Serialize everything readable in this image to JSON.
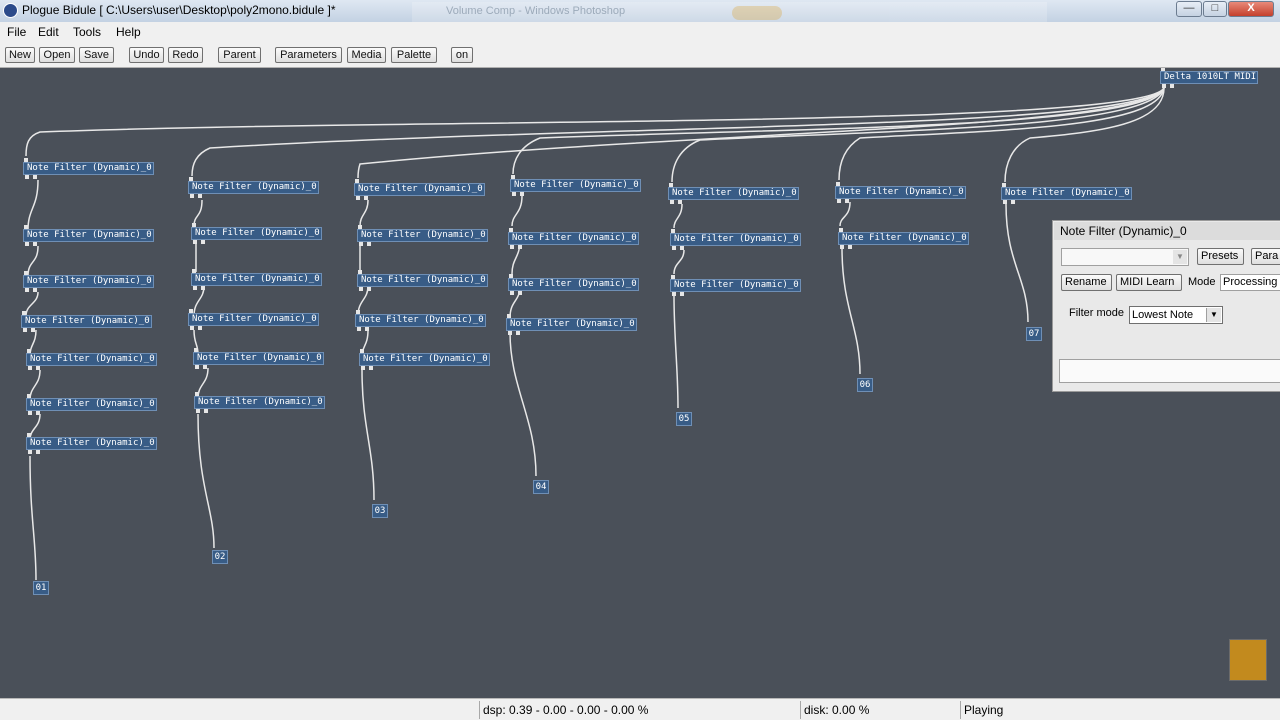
{
  "window": {
    "title": "Plogue Bidule [ C:\\Users\\user\\Desktop\\poly2mono.bidule ]*",
    "background_window_title": "Volume Comp - Windows Photoshop",
    "minimize": "—",
    "maximize": "□",
    "close": "X"
  },
  "menu": [
    "File",
    "Edit",
    "Tools",
    "Help"
  ],
  "toolbar": [
    "New",
    "Open",
    "Save",
    "Undo",
    "Redo",
    "Parent",
    "Parameters",
    "Media",
    "Palette",
    "on"
  ],
  "midi_device": "Delta 1010LT MIDI",
  "node_label": "Note Filter (Dynamic)_0",
  "outputs": [
    "01",
    "02",
    "03",
    "04",
    "05",
    "06",
    "07"
  ],
  "panel": {
    "title": "Note Filter (Dynamic)_0",
    "presets": "Presets",
    "parameters": "Para",
    "rename": "Rename",
    "midi_learn": "MIDI Learn",
    "mode_label": "Mode",
    "mode_value": "Processing",
    "filter_mode_label": "Filter mode",
    "filter_mode_value": "Lowest Note"
  },
  "status": {
    "dsp": "dsp:  0.39 -  0.00 -  0.00 -  0.00 %",
    "disk": "disk:  0.00 %",
    "state": "Playing"
  },
  "colors": {
    "canvas": "#4a5059",
    "node": "#385c86",
    "cable": "#e8e8e8",
    "indicator": "#c28a1e"
  }
}
